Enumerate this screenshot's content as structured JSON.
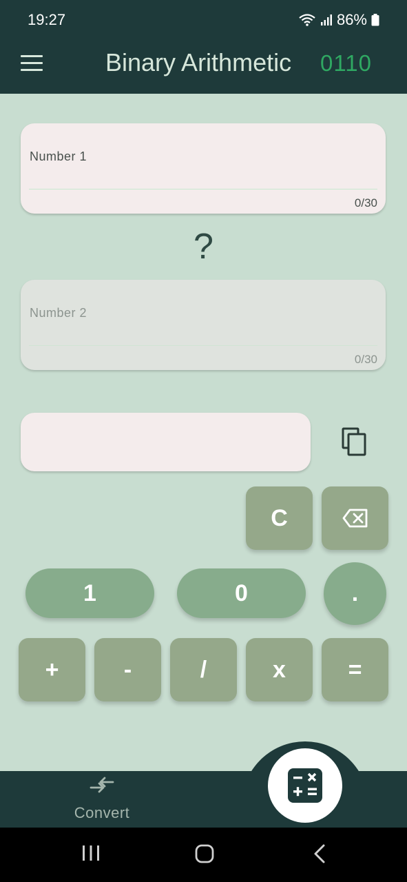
{
  "status_bar": {
    "time": "19:27",
    "battery": "86%"
  },
  "app_bar": {
    "title": "Binary Arithmetic",
    "badge": "0110"
  },
  "inputs": {
    "number1": {
      "label": "Number 1",
      "counter": "0/30"
    },
    "number2": {
      "label": "Number 2",
      "counter": "0/30"
    }
  },
  "operator": "?",
  "result": {
    "value": ""
  },
  "keypad": {
    "clear": "C",
    "one": "1",
    "zero": "0",
    "dot": ".",
    "plus": "+",
    "minus": "-",
    "divide": "/",
    "multiply": "x",
    "equals": "="
  },
  "bottom_nav": {
    "convert_label": "Convert"
  },
  "icons": {
    "menu": "menu-icon",
    "copy": "copy-icon",
    "backspace": "backspace-icon",
    "convert": "convert-arrows-icon",
    "calculator": "calculator-icon",
    "wifi": "wifi-icon",
    "signal": "signal-icon",
    "battery": "battery-icon"
  },
  "colors": {
    "header_bg": "#1e3a3a",
    "page_bg": "#c8ddd0",
    "badge_green": "#2fa862",
    "key_square": "#95a88a",
    "key_digit": "#87ac8c"
  }
}
